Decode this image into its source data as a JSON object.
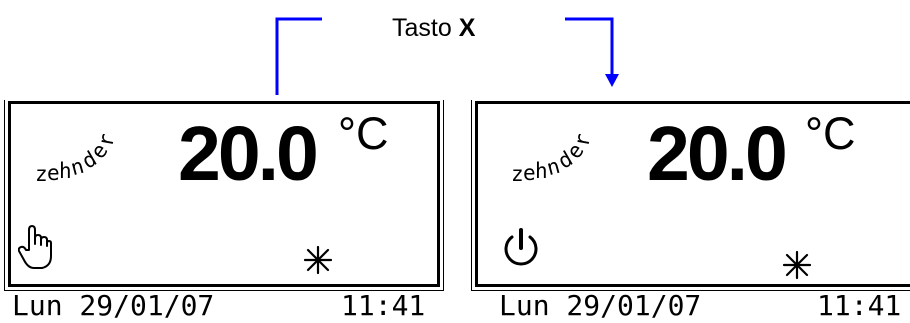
{
  "caption": {
    "label": "Tasto",
    "key": "X"
  },
  "panels": [
    {
      "brand": "zehnder",
      "temperature": "20.0",
      "unit": "°C",
      "mode_icon": "hand-pointer-icon",
      "season_icon": "snowflake-icon",
      "date": "Lun 29/01/07",
      "time": "11:41"
    },
    {
      "brand": "zehnder",
      "temperature": "20.0",
      "unit": "°C",
      "mode_icon": "power-icon",
      "season_icon": "snowflake-icon",
      "date": "Lun 29/01/07",
      "time": "11:41"
    }
  ],
  "colors": {
    "arrow": "#0000ff",
    "lcd_ink": "#000000",
    "background": "#ffffff"
  }
}
